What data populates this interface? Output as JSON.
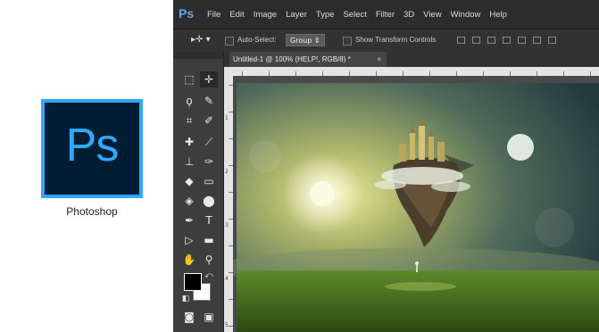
{
  "logo": {
    "text": "Ps",
    "label": "Photoshop"
  },
  "menubar": {
    "app_logo": "Ps",
    "items": [
      "File",
      "Edit",
      "Image",
      "Layer",
      "Type",
      "Select",
      "Filter",
      "3D",
      "View",
      "Window",
      "Help"
    ]
  },
  "options": {
    "auto_select_label": "Auto-Select:",
    "auto_select_value": "Group",
    "show_transform_label": "Show Transform Controls"
  },
  "document_tab": {
    "title": "Untitled-1 @ 100% (HELP!, RGB/8) *",
    "close": "×"
  },
  "ruler_left_labels": [
    "1",
    "2",
    "3",
    "4",
    "5"
  ],
  "colors": {
    "brand_blue": "#31a8ff",
    "logo_bg": "#001d34",
    "menubar_bg": "#2c2c2c",
    "foreground_swatch": "#000000",
    "background_swatch": "#ffffff"
  }
}
